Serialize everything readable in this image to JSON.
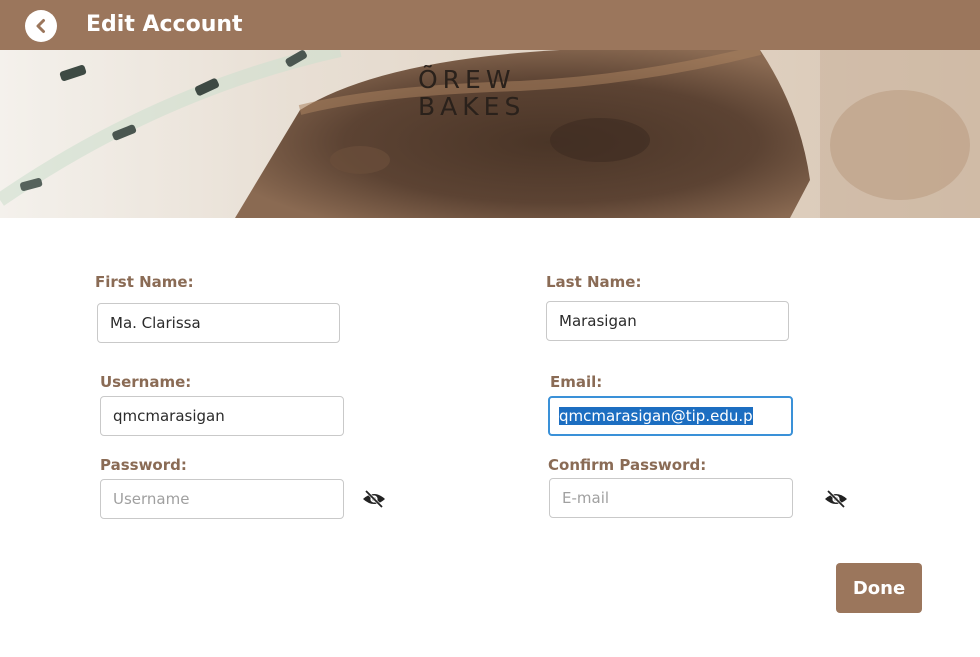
{
  "header": {
    "title": "Edit Account",
    "back_icon": "chevron-left-icon",
    "color": "#9b765c"
  },
  "banner": {
    "logo_line1": "ÕREW",
    "logo_line2": "BAKES"
  },
  "form": {
    "first_name": {
      "label": "First Name:",
      "value": "Ma. Clarissa"
    },
    "last_name": {
      "label": "Last Name:",
      "value": "Marasigan"
    },
    "username": {
      "label": "Username:",
      "value": "qmcmarasigan"
    },
    "email": {
      "label": "Email:",
      "value": "qmcmarasigan@tip.edu.p"
    },
    "password": {
      "label": "Password:",
      "placeholder": "Username",
      "toggle_icon": "eye-slash-icon"
    },
    "confirm_password": {
      "label": "Confirm Password:",
      "placeholder": "E-mail",
      "toggle_icon": "eye-slash-icon"
    }
  },
  "actions": {
    "done_label": "Done"
  },
  "colors": {
    "accent": "#9b765c",
    "label": "#8a6b55",
    "focus": "#3a91d8",
    "selection": "#1c6ec1"
  }
}
